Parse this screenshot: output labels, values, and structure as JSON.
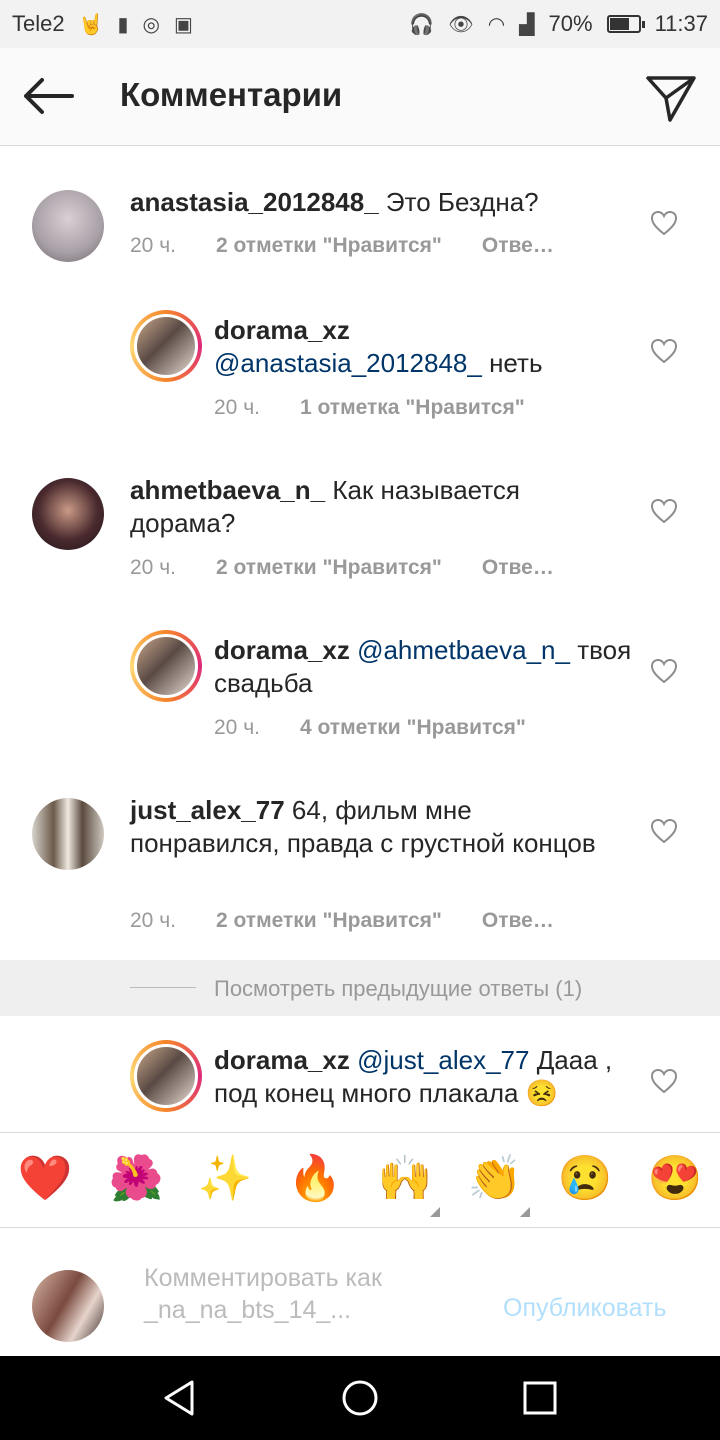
{
  "status_bar": {
    "carrier": "Tele2",
    "battery": "70%",
    "battery_level": 0.7,
    "time": "11:37"
  },
  "header": {
    "title": "Комментарии",
    "back_icon": "arrow-left-icon",
    "send_icon": "paper-plane-icon"
  },
  "comments": [
    {
      "username": "anastasia_2012848_",
      "mention": "",
      "text": "Это Бездна?",
      "time": "20 ч.",
      "likes": "2 отметки \"Нравится\"",
      "reply": "Отве…"
    },
    {
      "username": "dorama_xz",
      "mention": "@anastasia_2012848_",
      "text": "неть",
      "time": "20 ч.",
      "likes": "1 отметка \"Нравится\"",
      "reply": ""
    },
    {
      "username": "ahmetbaeva_n_",
      "mention": "",
      "text": "Как называется дорама?",
      "time": "20 ч.",
      "likes": "2 отметки \"Нравится\"",
      "reply": "Отве…"
    },
    {
      "username": "dorama_xz",
      "mention": "@ahmetbaeva_n_",
      "text": "твоя свадьба",
      "time": "20 ч.",
      "likes": "4 отметки \"Нравится\"",
      "reply": ""
    },
    {
      "username": "just_alex_77",
      "mention": "",
      "text": "64, фильм мне понравился, правда с грустной концов",
      "time": "20 ч.",
      "likes": "2 отметки \"Нравится\"",
      "reply": "Отве…"
    },
    {
      "username": "dorama_xz",
      "mention": "@just_alex_77",
      "text": "Дааа , под конец много плакала 😣",
      "time": "",
      "likes": "",
      "reply": ""
    }
  ],
  "view_previous": "Посмотреть предыдущие ответы (1)",
  "emoji_bar": [
    "❤️",
    "🌺",
    "✨",
    "🔥",
    "🙌",
    "👏",
    "😢",
    "😍"
  ],
  "input": {
    "placeholder_line1": "Комментировать как",
    "placeholder_line2": "_na_na_bts_14_...",
    "publish": "Опубликовать"
  },
  "colors": {
    "mention": "#003569",
    "meta_gray": "#999999",
    "publish_disabled": "#b2dffc"
  }
}
